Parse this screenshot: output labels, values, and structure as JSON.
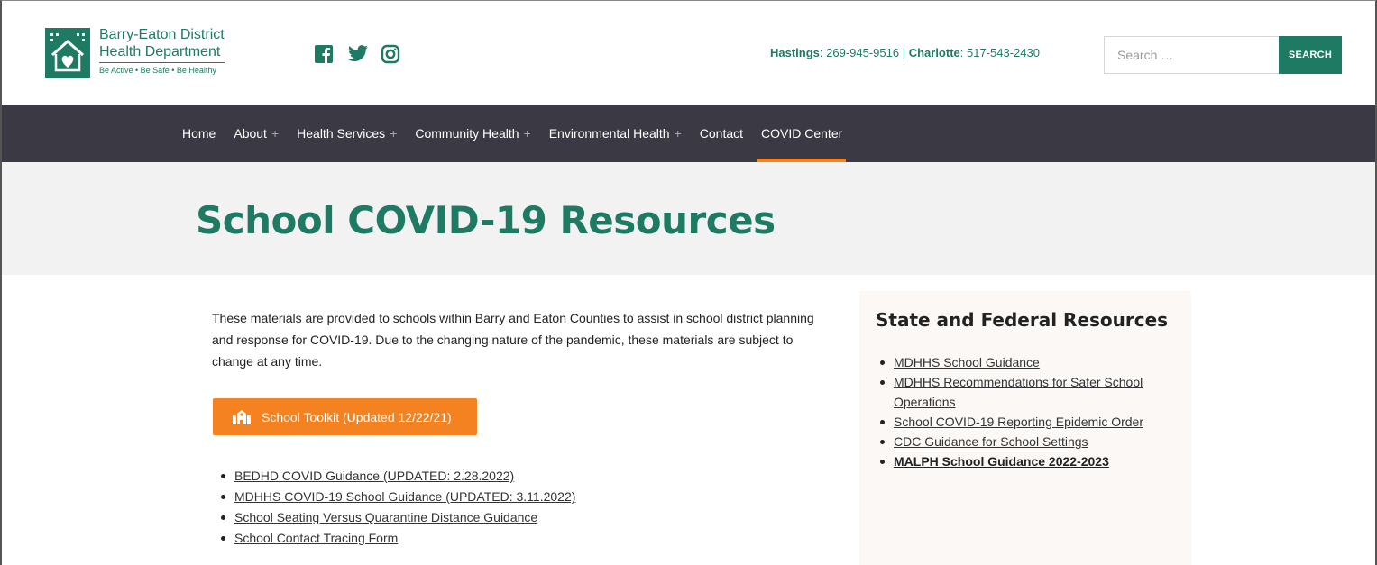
{
  "brand": {
    "line1": "Barry-Eaton District",
    "line2": "Health Department",
    "tagline": "Be Active • Be Safe • Be Healthy",
    "color": "#1f7a63"
  },
  "social": [
    "facebook-icon",
    "twitter-icon",
    "instagram-icon"
  ],
  "contact": {
    "hastings_label": "Hastings",
    "hastings_phone": ": 269-945-9516 | ",
    "charlotte_label": "Charlotte",
    "charlotte_phone": ": 517-543-2430"
  },
  "search": {
    "placeholder": "Search …",
    "button_label": "SEARCH"
  },
  "nav": {
    "items": [
      {
        "label": "Home",
        "has_submenu": false
      },
      {
        "label": "About",
        "has_submenu": true
      },
      {
        "label": "Health Services",
        "has_submenu": true
      },
      {
        "label": "Community Health",
        "has_submenu": true
      },
      {
        "label": "Environmental Health",
        "has_submenu": true
      },
      {
        "label": "Contact",
        "has_submenu": false
      },
      {
        "label": "COVID Center",
        "has_submenu": false,
        "active": true
      }
    ],
    "plus": "+",
    "accent": "#f58220"
  },
  "page": {
    "title": "School COVID-19 Resources"
  },
  "main": {
    "intro": "These materials are provided to schools within Barry and Eaton Counties to assist in school district planning and response for COVID-19.  Due to the changing nature of the pandemic, these materials are subject to change at any time.",
    "toolkit_label": "School Toolkit (Updated 12/22/21)",
    "links": [
      "BEDHD COVID Guidance (UPDATED: 2.28.2022)",
      "MDHHS COVID-19 School Guidance (UPDATED: 3.11.2022)",
      "School Seating Versus Quarantine Distance Guidance",
      "School Contact Tracing Form"
    ]
  },
  "sidebar": {
    "title": "State and Federal Resources",
    "links": [
      {
        "label": "MDHHS School Guidance",
        "bold": false
      },
      {
        "label": "MDHHS Recommendations for Safer School Operations",
        "bold": false
      },
      {
        "label": "School COVID-19 Reporting Epidemic Order",
        "bold": false
      },
      {
        "label": "CDC Guidance for School Settings",
        "bold": false
      },
      {
        "label": "MALPH School Guidance 2022-2023",
        "bold": true
      }
    ]
  }
}
